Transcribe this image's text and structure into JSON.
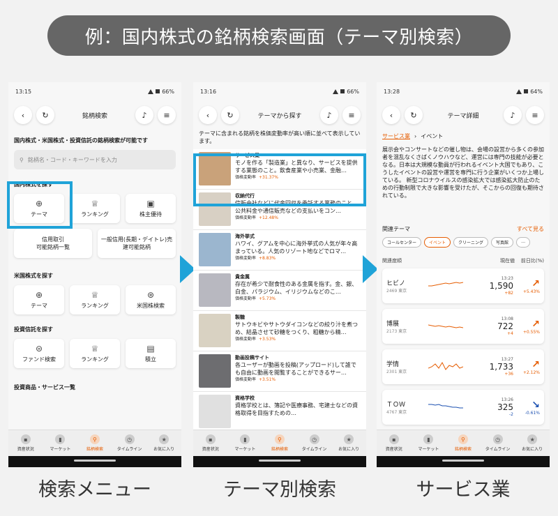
{
  "banner": "例：国内株式の銘柄検索画面（テーマ別検索）",
  "colors": {
    "accent": "#e65c00",
    "highlight": "#1fa3d8",
    "down": "#1a4fb0"
  },
  "tabs": [
    {
      "label": "資産状況",
      "icon": "wallet-icon"
    },
    {
      "label": "マーケット",
      "icon": "bar-chart-icon"
    },
    {
      "label": "銘柄検索",
      "icon": "search-icon"
    },
    {
      "label": "タイムライン",
      "icon": "clock-icon"
    },
    {
      "label": "お気に入り",
      "icon": "star-icon"
    }
  ],
  "phone1": {
    "time": "13:15",
    "battery": "66%",
    "title": "銘柄検索",
    "intro": "国内株式・米国株式・投資信託の銘柄検索が可能です",
    "search_placeholder": "銘柄名・コード・キーワードを入力",
    "domestic_title": "国内株式を探す",
    "domestic_tiles": [
      "テーマ",
      "ランキング",
      "株主優待"
    ],
    "domestic_wide": [
      "信用取引\n可能銘柄一覧",
      "一般信用(長期・デイトレ)売建可能銘柄"
    ],
    "us_title": "米国株式を探す",
    "us_tiles": [
      "テーマ",
      "ランキング",
      "米国株検索"
    ],
    "fund_title": "投資信託を探す",
    "fund_tiles": [
      "ファンド検索",
      "ランキング",
      "積立"
    ],
    "products_title": "投資商品・サービス一覧",
    "caption": "検索メニュー"
  },
  "phone2": {
    "time": "13:16",
    "battery": "66%",
    "title": "テーマから探す",
    "intro": "テーマに含まれる銘柄を株価変動率が高い順に並べて表示しています。",
    "rate_label": "価格変動率",
    "items": [
      {
        "name": "サービス業",
        "desc": "モノを作る「製造業」と異なり、サービスを提供する業態のこと。飲食産業や小売業、金融…",
        "rate": "+31.37%"
      },
      {
        "name": "収納代行",
        "desc": "信販会社などに代金回収を委託する業務のこと。公共料金や通信販売などの支払いをコン…",
        "rate": "+12.48%"
      },
      {
        "name": "海外挙式",
        "desc": "ハワイ、グアムを中心に海外挙式の人気が年々高まっている。人気のリゾート地などでロマ…",
        "rate": "+8.83%"
      },
      {
        "name": "貴金属",
        "desc": "存在が希少で耐食性のある金属を指す。金、銀、白金、パラジウム、イリジウムなどのこ…",
        "rate": "+5.73%"
      },
      {
        "name": "製糖",
        "desc": "サトウキビやサトウダイコンなどの絞り汁を煮つめ、結晶させて砂糖をつくり、粗糖から精…",
        "rate": "+3.53%"
      },
      {
        "name": "動画投稿サイト",
        "desc": "各ユーザーが動画を投稿(アップロード)して誰でも自由に動画を閲覧することができるサー…",
        "rate": "+3.51%"
      },
      {
        "name": "資格学校",
        "desc": "資格学校とは、簿記や医療事務、宅建士などの資格取得を目指すための…",
        "rate": ""
      }
    ],
    "caption": "テーマ別検索"
  },
  "phone3": {
    "time": "13:28",
    "battery": "64%",
    "title": "テーマ詳細",
    "crumb_parent": "サービス業",
    "crumb_child": "イベント",
    "description": "展示会やコンサートなどの催し物は、会場の設営から多くの参加者を混乱なくさばくノウハウなど、運営には専門の技能が必要となる。日本は大規模な動員が行われるイベント大国でもあり、こうしたイベントの設営や運営を専門に行う企業がいくつか上場している。 新型コロナウイルスの感染拡大では感染拡大防止のための行動制限で大きな影響を受けたが、そこからの回復も期待されている。",
    "related_label": "関連テーマ",
    "more_label": "すべて見る",
    "chips": [
      "コールセンター",
      "イベント",
      "クリーニング",
      "写真館",
      "…"
    ],
    "col_relevance": "関連度順",
    "col_price": "現在値",
    "col_change": "前日比(%)",
    "stocks": [
      {
        "name": "ヒビノ",
        "code": "2469 東京",
        "time": "13:23",
        "price": "1,590",
        "diff": "+82",
        "pct": "+5.43%",
        "dir": "up",
        "spark": [
          0.5,
          0.5,
          0.45,
          0.4,
          0.35,
          0.3,
          0.35,
          0.3,
          0.25,
          0.3,
          0.25
        ]
      },
      {
        "name": "博展",
        "code": "2173 東京",
        "time": "13:08",
        "price": "722",
        "diff": "+4",
        "pct": "+0.55%",
        "dir": "up",
        "spark": [
          0.4,
          0.45,
          0.5,
          0.45,
          0.5,
          0.55,
          0.5,
          0.55,
          0.6,
          0.55,
          0.6
        ]
      },
      {
        "name": "学情",
        "code": "2301 東京",
        "time": "13:27",
        "price": "1,733",
        "diff": "+36",
        "pct": "+2.12%",
        "dir": "up",
        "spark": [
          0.6,
          0.5,
          0.3,
          0.6,
          0.2,
          0.7,
          0.4,
          0.5,
          0.3,
          0.6,
          0.5
        ]
      },
      {
        "name": "ＴＯＷ",
        "code": "4767 東京",
        "time": "13:26",
        "price": "325",
        "diff": "-2",
        "pct": "-0.61%",
        "dir": "down",
        "spark": [
          0.3,
          0.3,
          0.35,
          0.3,
          0.4,
          0.4,
          0.45,
          0.5,
          0.5,
          0.55,
          0.55
        ]
      }
    ],
    "caption": "サービス業"
  }
}
